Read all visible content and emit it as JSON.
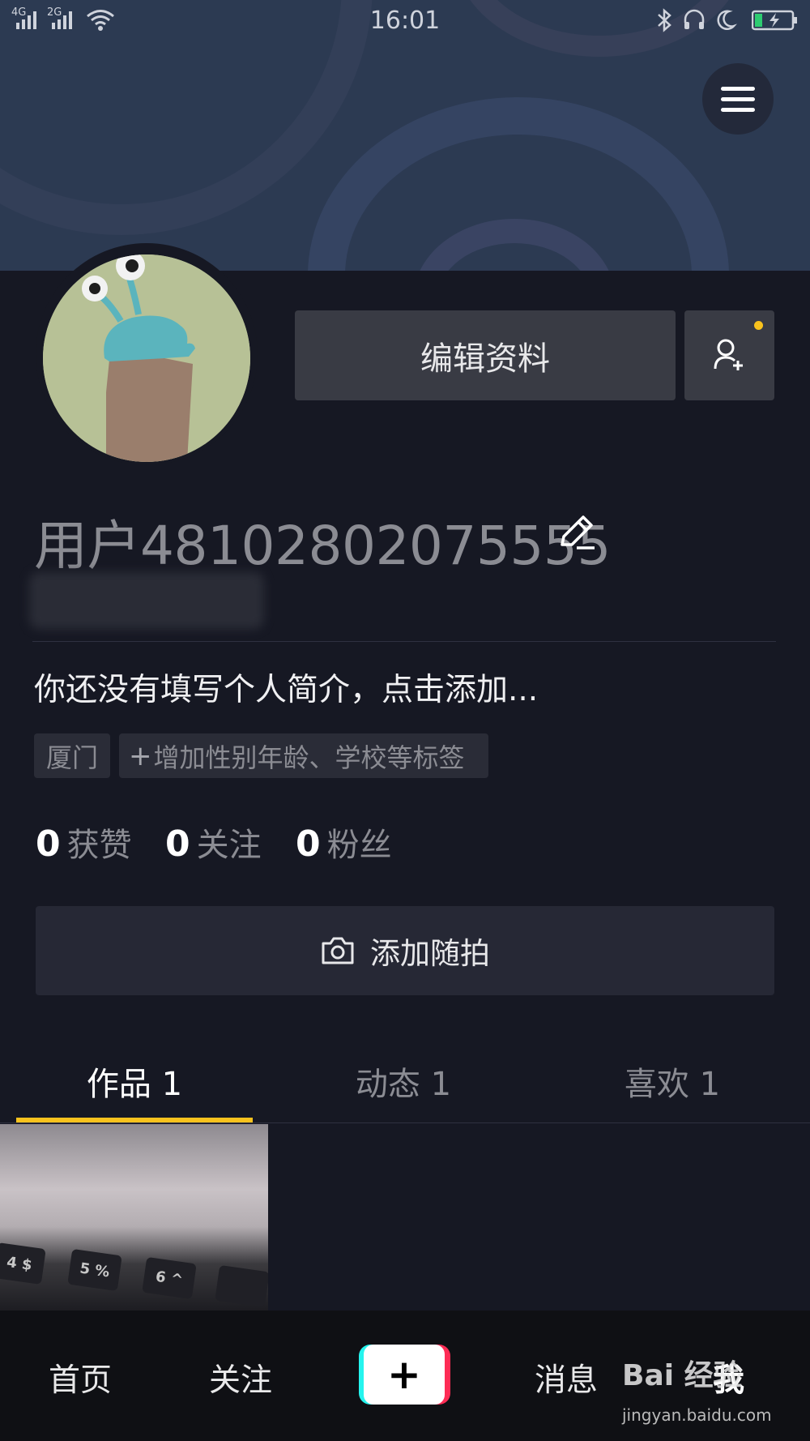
{
  "status_bar": {
    "time": "16:01",
    "network_1": "4G",
    "network_2": "2G"
  },
  "profile": {
    "edit_button_label": "编辑资料",
    "username": "用户48102802075555",
    "bio_placeholder": "你还没有填写个人简介，点击添加...",
    "tags": {
      "city": "厦门",
      "add_tags_label": "增加性别年龄、学校等标签"
    },
    "stats": [
      {
        "value": "0",
        "label": "获赞"
      },
      {
        "value": "0",
        "label": "关注"
      },
      {
        "value": "0",
        "label": "粉丝"
      }
    ],
    "snapshot_button_label": "添加随拍"
  },
  "tabs": [
    {
      "label": "作品 1",
      "active": true
    },
    {
      "label": "动态 1",
      "active": false
    },
    {
      "label": "喜欢 1",
      "active": false
    }
  ],
  "thumbnail_keys": [
    "4 $",
    "5 %",
    "6 ^"
  ],
  "bottom_nav": {
    "home": "首页",
    "follow": "关注",
    "create": "+",
    "messages": "消息",
    "me": "我"
  },
  "watermark": {
    "brand": "Bai 经验",
    "url": "jingyan.baidu.com"
  },
  "colors": {
    "accent_yellow": "#f8c21d",
    "background": "#161823",
    "banner": "#2c3a52",
    "create_cyan": "#25f4ee",
    "create_red": "#fe2c55"
  }
}
